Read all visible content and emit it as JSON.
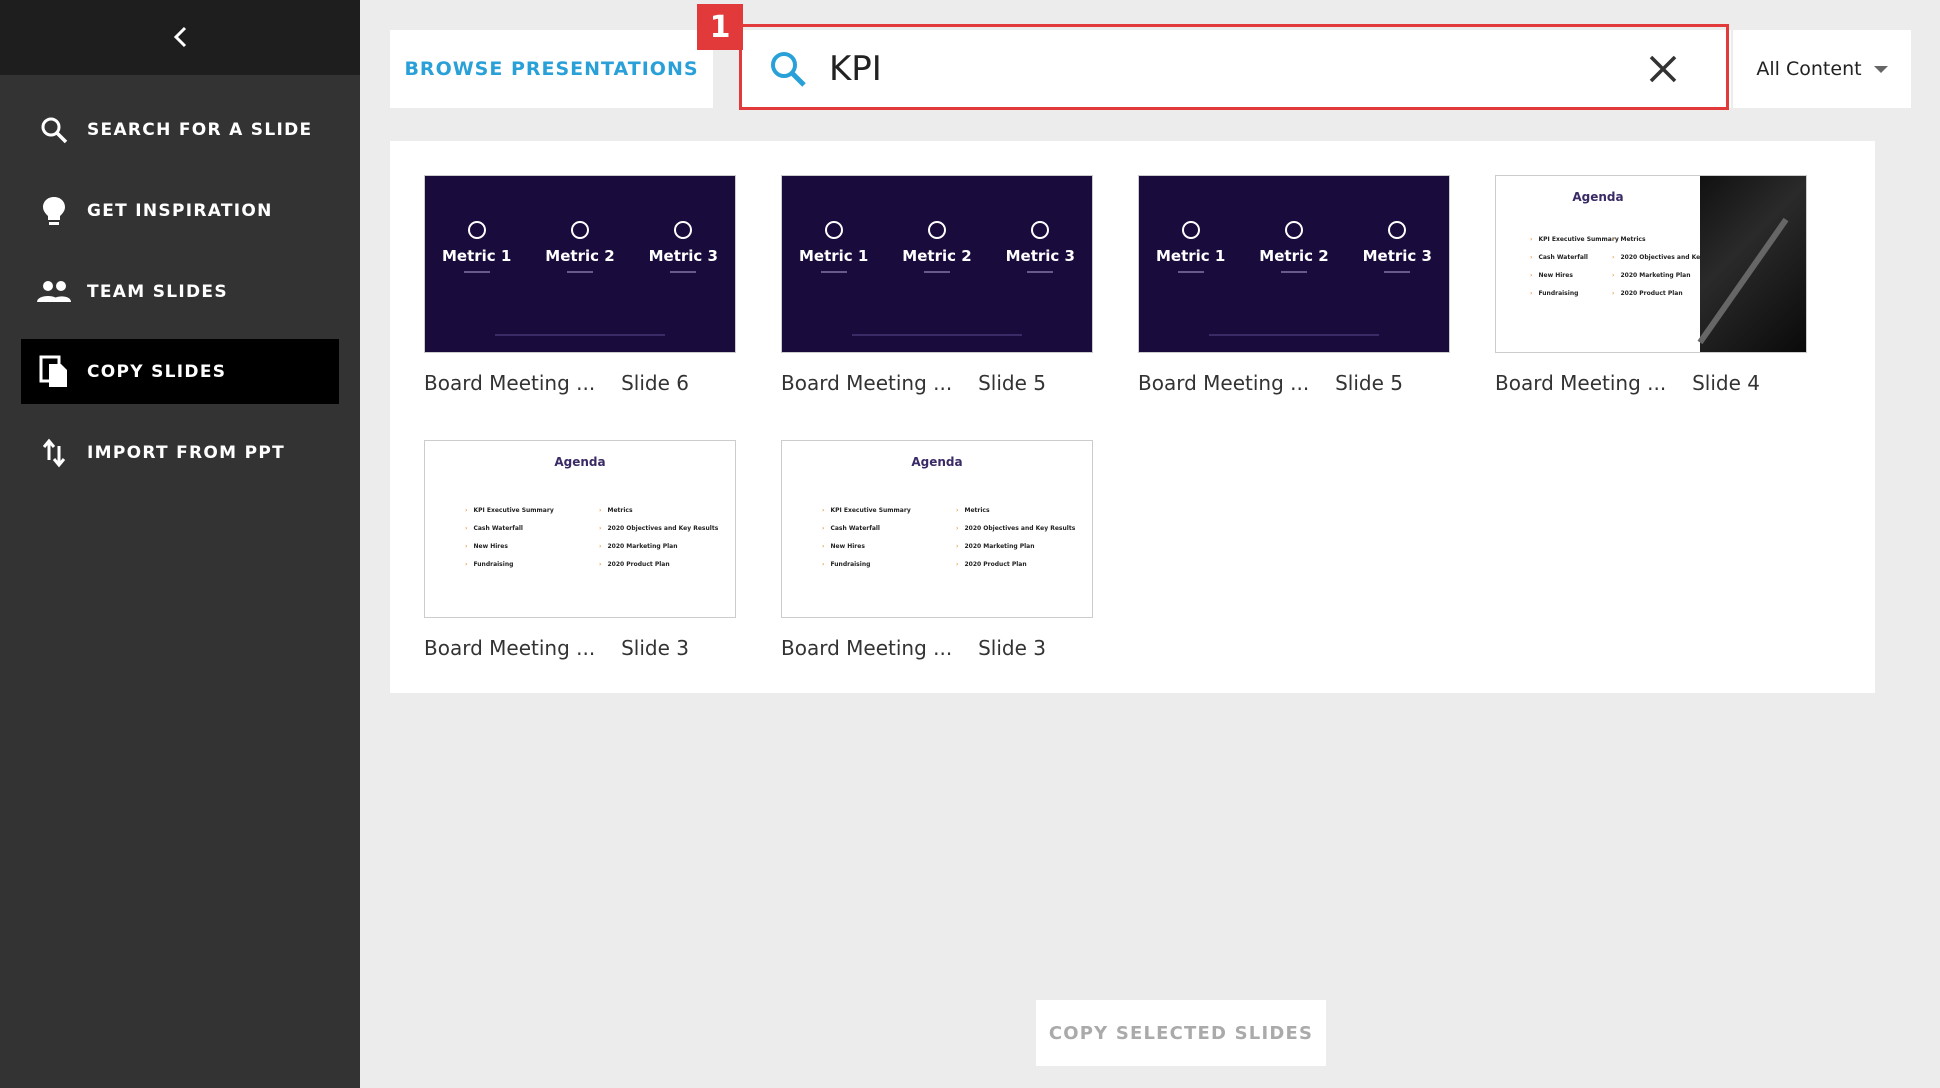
{
  "sidebar": {
    "items": [
      {
        "label": "SEARCH FOR A SLIDE",
        "icon": "search-icon"
      },
      {
        "label": "GET INSPIRATION",
        "icon": "lightbulb-icon"
      },
      {
        "label": "TEAM SLIDES",
        "icon": "people-icon"
      },
      {
        "label": "COPY SLIDES",
        "icon": "copy-icon",
        "active": true
      },
      {
        "label": "IMPORT FROM PPT",
        "icon": "import-icon"
      }
    ]
  },
  "header": {
    "browse_label": "BROWSE PRESENTATIONS",
    "search_value": "KPI",
    "filter_label": "All Content",
    "annotation_number": "1"
  },
  "results": [
    {
      "presentation": "Board Meeting ...",
      "slide": "Slide 6",
      "style": "metrics"
    },
    {
      "presentation": "Board Meeting ...",
      "slide": "Slide 5",
      "style": "metrics"
    },
    {
      "presentation": "Board Meeting ...",
      "slide": "Slide 5",
      "style": "metrics"
    },
    {
      "presentation": "Board Meeting ...",
      "slide": "Slide 4",
      "style": "agenda-photo"
    },
    {
      "presentation": "Board Meeting ...",
      "slide": "Slide 3",
      "style": "agenda"
    },
    {
      "presentation": "Board Meeting ...",
      "slide": "Slide 3",
      "style": "agenda"
    }
  ],
  "thumbnails": {
    "metrics": [
      "Metric 1",
      "Metric 2",
      "Metric 3"
    ],
    "agenda_title": "Agenda",
    "agenda_left": [
      "KPI Executive Summary",
      "Cash Waterfall",
      "New Hires",
      "Fundraising"
    ],
    "agenda_right": [
      "Metrics",
      "2020 Objectives and Key Results",
      "2020 Marketing Plan",
      "2020 Product Plan"
    ]
  },
  "footer": {
    "copy_label": "COPY SELECTED SLIDES"
  },
  "colors": {
    "accent": "#2aa0d8",
    "annotation": "#e23a3a",
    "sidebar_bg": "#333333",
    "slide_dark": "#1a0b3d"
  }
}
